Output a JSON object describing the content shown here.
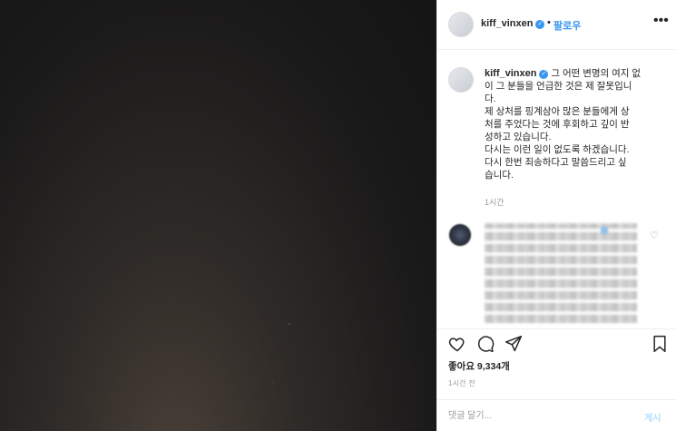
{
  "post": {
    "username": "kiff_vinxen",
    "follow_label": "팔로우",
    "more_icon": "more-horizontal-icon",
    "verified_icon": "verified-badge-icon"
  },
  "caption": {
    "username": "kiff_vinxen",
    "lines": [
      "그 어떤 변명의 여지 없",
      "이 그 분들을 언급한 것은 제 잘못입니",
      "다.",
      "제 상처를 핑계삼아 많은 분들에게 상",
      "처를 주었다는 것에 후회하고 깊이 반",
      "성하고 있습니다.",
      "다시는 이런 일이 없도록 하겠습니다.",
      "다시 한번 죄송하다고 말씀드리고 싶",
      "습니다."
    ],
    "time": "1시간"
  },
  "actions": {
    "like_icon": "heart-icon",
    "comment_icon": "comment-icon",
    "share_icon": "share-icon",
    "save_icon": "bookmark-icon"
  },
  "likes_text": "좋아요 9,334개",
  "post_time": "1시간 전",
  "comment_bar": {
    "placeholder": "댓글 달기...",
    "post_label": "게시"
  },
  "colors": {
    "accent": "#3897f0",
    "post_disabled": "#b2dffc",
    "muted": "#999999"
  }
}
